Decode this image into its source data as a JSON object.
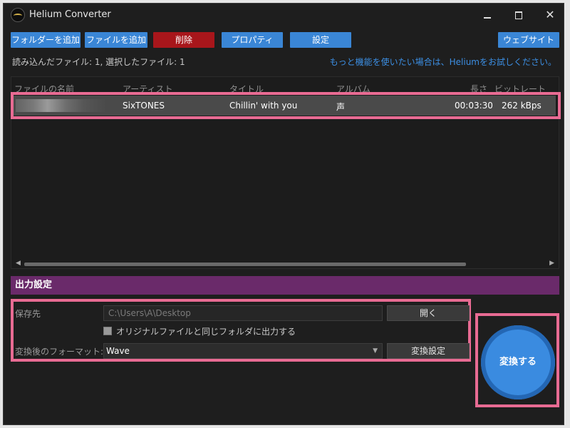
{
  "window": {
    "title": "Helium Converter"
  },
  "toolbar": {
    "add_folder": "フォルダーを追加",
    "add_file": "ファイルを追加",
    "delete": "削除",
    "properties": "プロパティ",
    "settings": "設定",
    "website": "ウェブサイト"
  },
  "status": {
    "loaded_files": "読み込んだファイル: 1, 選択したファイル: 1",
    "promo": "もっと機能を使いたい場合は、Heliumをお試しください。"
  },
  "file_list": {
    "columns": [
      "ファイルの名前",
      "アーティスト",
      "タイトル",
      "アルバム",
      "長さ",
      "ビットレート"
    ],
    "rows": [
      {
        "filename": "",
        "artist": "SixTONES",
        "title": "Chillin' with you",
        "album": "声",
        "length": "00:03:30",
        "bitrate": "262 kBps"
      }
    ]
  },
  "output": {
    "section_title": "出力設定",
    "save_to_label": "保存先",
    "save_path": "C:\\Users\\A\\Desktop",
    "open_button": "開く",
    "same_folder_label": "オリジナルファイルと同じフォルダに出力する",
    "same_folder_checked": false,
    "format_label": "変換後のフォーマット:",
    "format_value": "Wave",
    "conversion_settings_button": "変換設定"
  },
  "convert_button": "変換する",
  "colors": {
    "accent_blue": "#3a86d6",
    "delete_red": "#a8161b",
    "section_purple": "#6a2a6a",
    "highlight_pink": "#e86b93",
    "link_blue": "#3c8fe4"
  }
}
